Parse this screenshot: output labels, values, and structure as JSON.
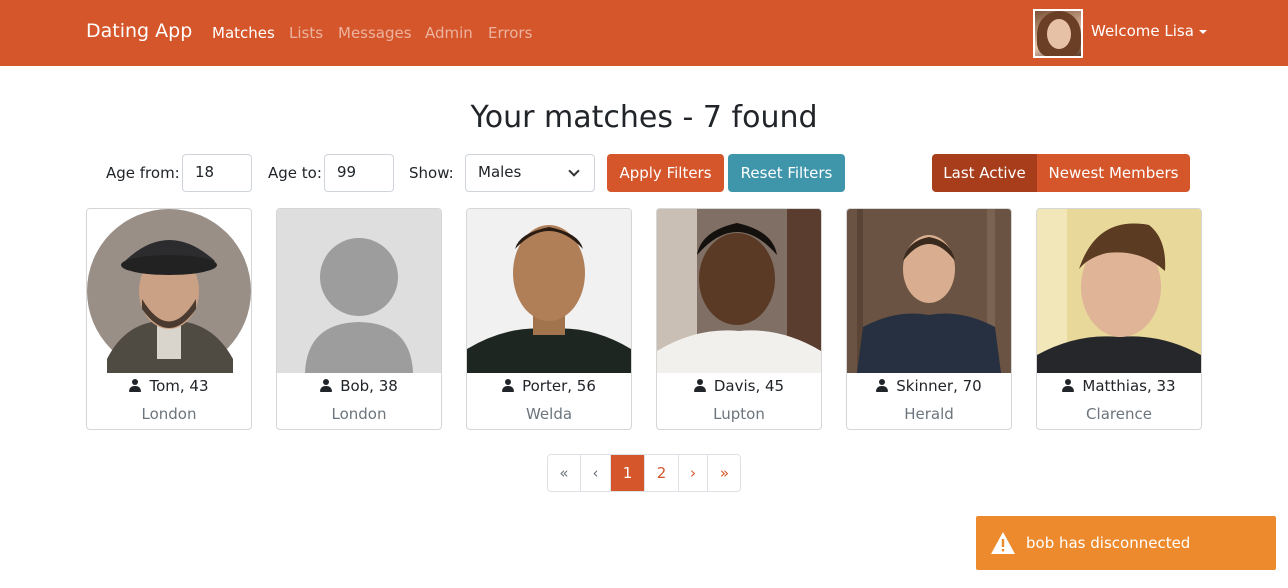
{
  "navbar": {
    "brand": "Dating App",
    "links": [
      "Matches",
      "Lists",
      "Messages",
      "Admin",
      "Errors"
    ],
    "active": "Matches",
    "welcome": "Welcome Lisa",
    "color": "#d4562a"
  },
  "page": {
    "title": "Your matches - 7 found"
  },
  "filters": {
    "age_from_label": "Age from:",
    "age_from_value": "18",
    "age_to_label": "Age to:",
    "age_to_value": "99",
    "show_label": "Show:",
    "show_value": "Males",
    "apply_label": "Apply Filters",
    "reset_label": "Reset Filters",
    "sort": [
      "Last Active",
      "Newest Members"
    ],
    "sort_active": "Last Active"
  },
  "members": [
    {
      "name": "Tom, 43",
      "city": "London"
    },
    {
      "name": "Bob, 38",
      "city": "London"
    },
    {
      "name": "Porter, 56",
      "city": "Welda"
    },
    {
      "name": "Davis, 45",
      "city": "Lupton"
    },
    {
      "name": "Skinner, 70",
      "city": "Herald"
    },
    {
      "name": "Matthias, 33",
      "city": "Clarence"
    }
  ],
  "pagination": {
    "first": "«",
    "prev": "‹",
    "pages": [
      "1",
      "2"
    ],
    "current": "1",
    "next": "›",
    "last": "»"
  },
  "toast": {
    "message": "bob has disconnected",
    "color": "#ee8a2e"
  },
  "icons": [
    "user-icon",
    "warning-icon",
    "chevron-down-icon",
    "caret-down-icon"
  ]
}
